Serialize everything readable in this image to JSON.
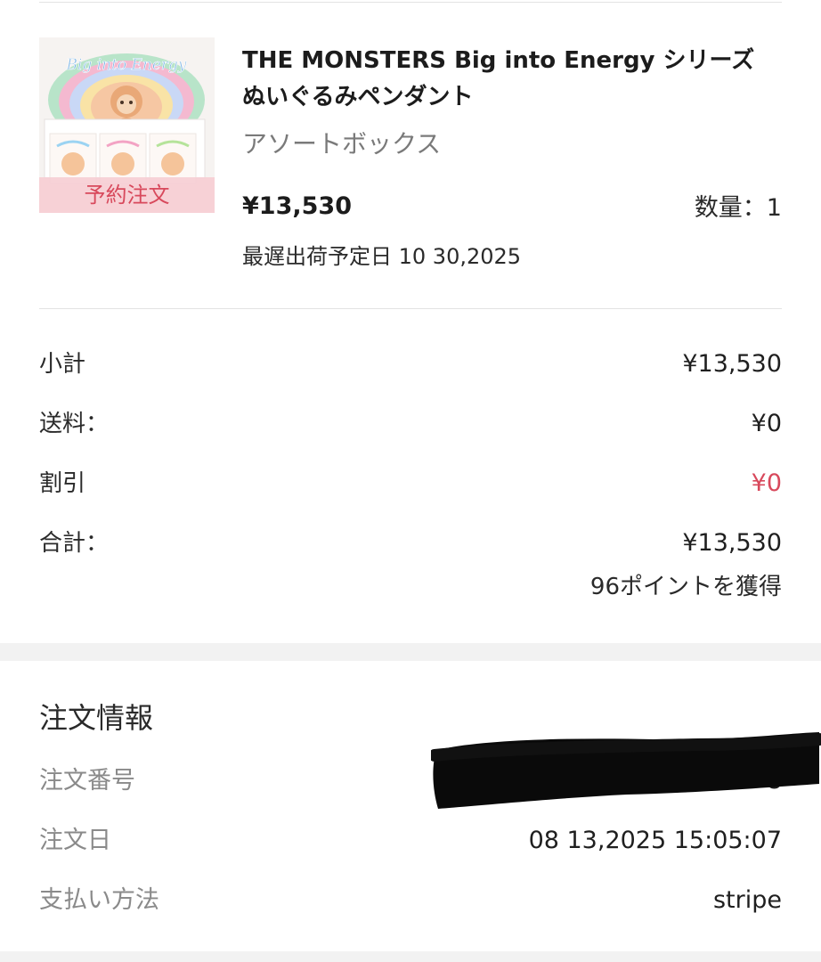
{
  "product": {
    "title": "THE MONSTERS Big into Energy シリーズ ぬいぐるみペンダント",
    "variant": "アソートボックス",
    "price": "¥13,530",
    "quantity": "数量：1",
    "shipping_date": "最遅出荷予定日 10 30,2025",
    "badge": "予約注文",
    "image_logo_text": "Big into Energy"
  },
  "summary": {
    "subtotal_label": "小計",
    "subtotal_value": "¥13,530",
    "shipping_label": "送料：",
    "shipping_value": "¥0",
    "discount_label": "割引",
    "discount_value": "¥0",
    "total_label": "合計：",
    "total_value": "¥13,530",
    "points": "96ポイントを獲得"
  },
  "order": {
    "title": "注文情報",
    "number_label": "注文番号",
    "number_value_visible": "8",
    "date_label": "注文日",
    "date_value": "08 13,2025 15:05:07",
    "payment_label": "支払い方法",
    "payment_value": "stripe"
  },
  "colors": {
    "accent_red": "#d8495c",
    "badge_bg": "#f6ced4",
    "muted_text": "#8a8a8a",
    "band_gray": "#f2f2f2"
  }
}
